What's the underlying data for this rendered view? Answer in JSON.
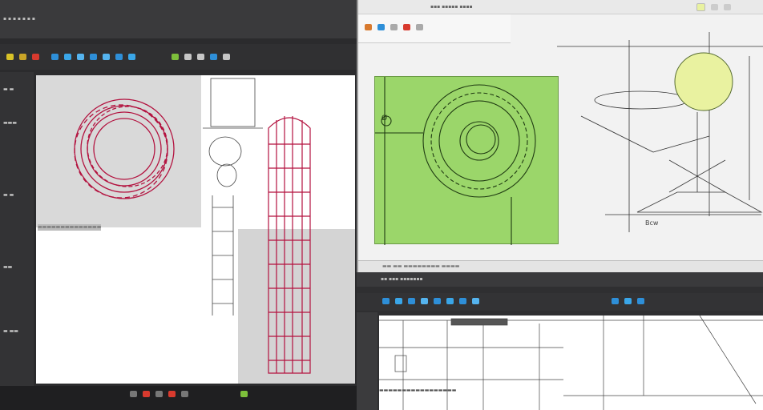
{
  "left_app": {
    "menu_text": "▪ ▪ ▪ ▪ ▪ ▪ ▪",
    "sidebar_lines": [
      "▬ ▬",
      "▬▬▬",
      "▬ ▬",
      "▬▬",
      "▬ ▬▬"
    ],
    "ring_caption": "▬▬▬▬▬▬▬▬▬▬▬▬▬▬",
    "toolbar_colors": [
      "#d8c227",
      "#c9a427",
      "#d83a2e",
      "#2e8fd8",
      "#3aa6e8",
      "#55b4ef",
      "#7dbf3b",
      "#c6c6c6",
      "#2e8fd8"
    ]
  },
  "right_top_app": {
    "window_text": "▪▪▪ ▪▪▪▪▪ ▪▪▪▪",
    "status_text": "▬▬ ▬▬ ▬▬▬▬▬▬▬▬ ▬▬▬▬",
    "sketch_label": "Ø",
    "sketch_label2": "Bcw"
  },
  "right_bottom_app": {
    "title_text": "▪▪ ▪▪▪ ▪▪▪▪▪▪▪",
    "caption_text": "▬▬▬▬▬▬▬▬▬▬▬▬▬▬▬▬▬"
  },
  "colors": {
    "accent": "#2e8fd8",
    "canvas_green": "#9bd66a",
    "sketch_red": "#b3123f",
    "sketch_yellow": "#e9f2a0"
  }
}
